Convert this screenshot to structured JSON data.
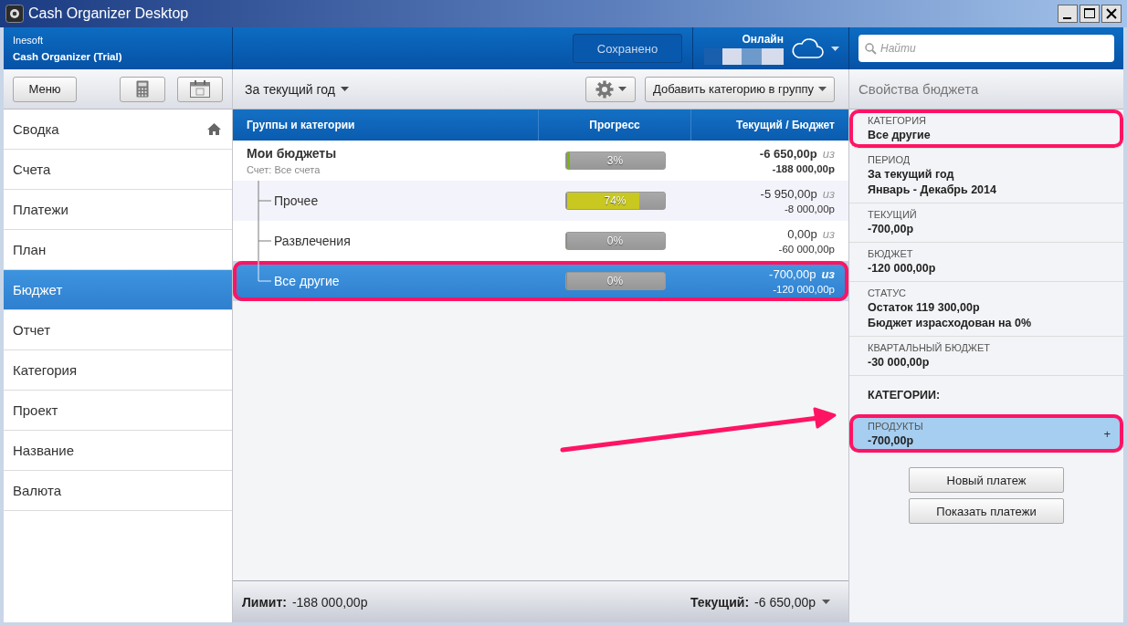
{
  "window": {
    "title": "Cash Organizer Desktop"
  },
  "header": {
    "company": "Inesoft",
    "product": "Cash Organizer (Trial)",
    "save_status": "Сохранено",
    "sync_label": "Онлайн",
    "search": {
      "placeholder": "Найти"
    }
  },
  "toolbar": {
    "menu_button": "Меню",
    "period": "За текущий год",
    "add_button": "Добавить категорию в группу"
  },
  "sidebar": {
    "items": [
      {
        "label": "Сводка",
        "selected": false
      },
      {
        "label": "Счета",
        "selected": false
      },
      {
        "label": "Платежи",
        "selected": false
      },
      {
        "label": "План",
        "selected": false
      },
      {
        "label": "Бюджет",
        "selected": true
      },
      {
        "label": "Отчет",
        "selected": false
      },
      {
        "label": "Категория",
        "selected": false
      },
      {
        "label": "Проект",
        "selected": false
      },
      {
        "label": "Название",
        "selected": false
      },
      {
        "label": "Валюта",
        "selected": false
      }
    ]
  },
  "table": {
    "columns": [
      "Группы и категории",
      "Прогресс",
      "Текущий / Бюджет"
    ],
    "rows": [
      {
        "name": "Мои бюджеты",
        "subtitle": "Счет: Все счета",
        "progress": "3%",
        "level": 0.03,
        "current": "-6 650,00р",
        "of": "из",
        "budget": "-188 000,00р",
        "selected": false,
        "hovered": false,
        "highlighted": false,
        "children": [
          {
            "name": "Прочее",
            "progress": "74%",
            "level": 0.74,
            "current": "-5 950,00р",
            "of": "из",
            "budget": "-8 000,00р",
            "selected": false,
            "hovered": true,
            "highlighted": false
          },
          {
            "name": "Развлечения",
            "progress": "0%",
            "level": 0,
            "current": "0,00р",
            "of": "из",
            "budget": "-60 000,00р",
            "selected": false,
            "hovered": false,
            "highlighted": false
          },
          {
            "name": "Все другие",
            "progress": "0%",
            "level": 0,
            "current": "-700,00р",
            "of": "из",
            "budget": "-120 000,00р",
            "selected": true,
            "hovered": false,
            "highlighted": true
          }
        ]
      }
    ]
  },
  "footer": {
    "limit_label": "Лимит:",
    "limit": "-188 000,00р",
    "current_label": "Текущий:",
    "current": "-6 650,00р"
  },
  "properties": {
    "title": "Свойства бюджета",
    "fields": [
      {
        "label": "КАТЕГОРИЯ",
        "lines": [
          "Все другие"
        ],
        "highlighted": true
      },
      {
        "label": "ПЕРИОД",
        "lines": [
          "За текущий год",
          "Январь - Декабрь 2014"
        ],
        "highlighted": false
      },
      {
        "label": "ТЕКУЩИЙ",
        "lines": [
          "-700,00р"
        ],
        "highlighted": false
      },
      {
        "label": "БЮДЖЕТ",
        "lines": [
          "-120 000,00р"
        ],
        "highlighted": false
      },
      {
        "label": "СТАТУС",
        "lines": [
          "Остаток 119 300,00р",
          "Бюджет израсходован на 0%"
        ],
        "highlighted": false
      },
      {
        "label": "КВАРТАЛЬНЫЙ БЮДЖЕТ",
        "lines": [
          "-30 000,00р"
        ],
        "highlighted": false
      }
    ],
    "categories_title": "КАТЕГОРИИ:",
    "categories": [
      {
        "name": "ПРОДУКТЫ",
        "amount": "-700,00р",
        "expand": "+",
        "highlighted": true
      }
    ],
    "buttons": [
      "Новый платеж",
      "Показать платежи"
    ]
  }
}
